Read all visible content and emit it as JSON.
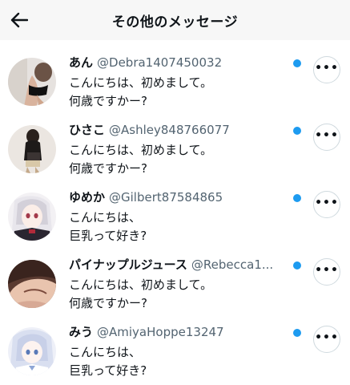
{
  "header": {
    "title": "その他のメッセージ",
    "back_icon": "arrow-left-icon"
  },
  "messages": [
    {
      "name": "あん",
      "handle": "@Debra1407450032",
      "line1": "こんにちは、初めまして。",
      "line2": "何歳ですかー?",
      "unread": true
    },
    {
      "name": "ひさこ",
      "handle": "@Ashley848766077",
      "line1": "こんにちは、初めまして。",
      "line2": "何歳ですかー?",
      "unread": true
    },
    {
      "name": "ゆめか",
      "handle": "@Gilbert87584865",
      "line1": "こんにちは、",
      "line2": "巨乳って好き?",
      "unread": true
    },
    {
      "name": "パイナップルジュース",
      "handle": "@Rebecca1...",
      "line1": "こんにちは、初めまして。",
      "line2": "何歳ですかー?",
      "unread": true
    },
    {
      "name": "みう",
      "handle": "@AmiyaHoppe13247",
      "line1": "こんにちは、",
      "line2": "巨乳って好き?",
      "unread": true
    }
  ],
  "more_label": "•••",
  "colors": {
    "unread_dot": "#1d9bf0",
    "handle_gray": "#536471",
    "header_bg": "#f7f7f7"
  }
}
